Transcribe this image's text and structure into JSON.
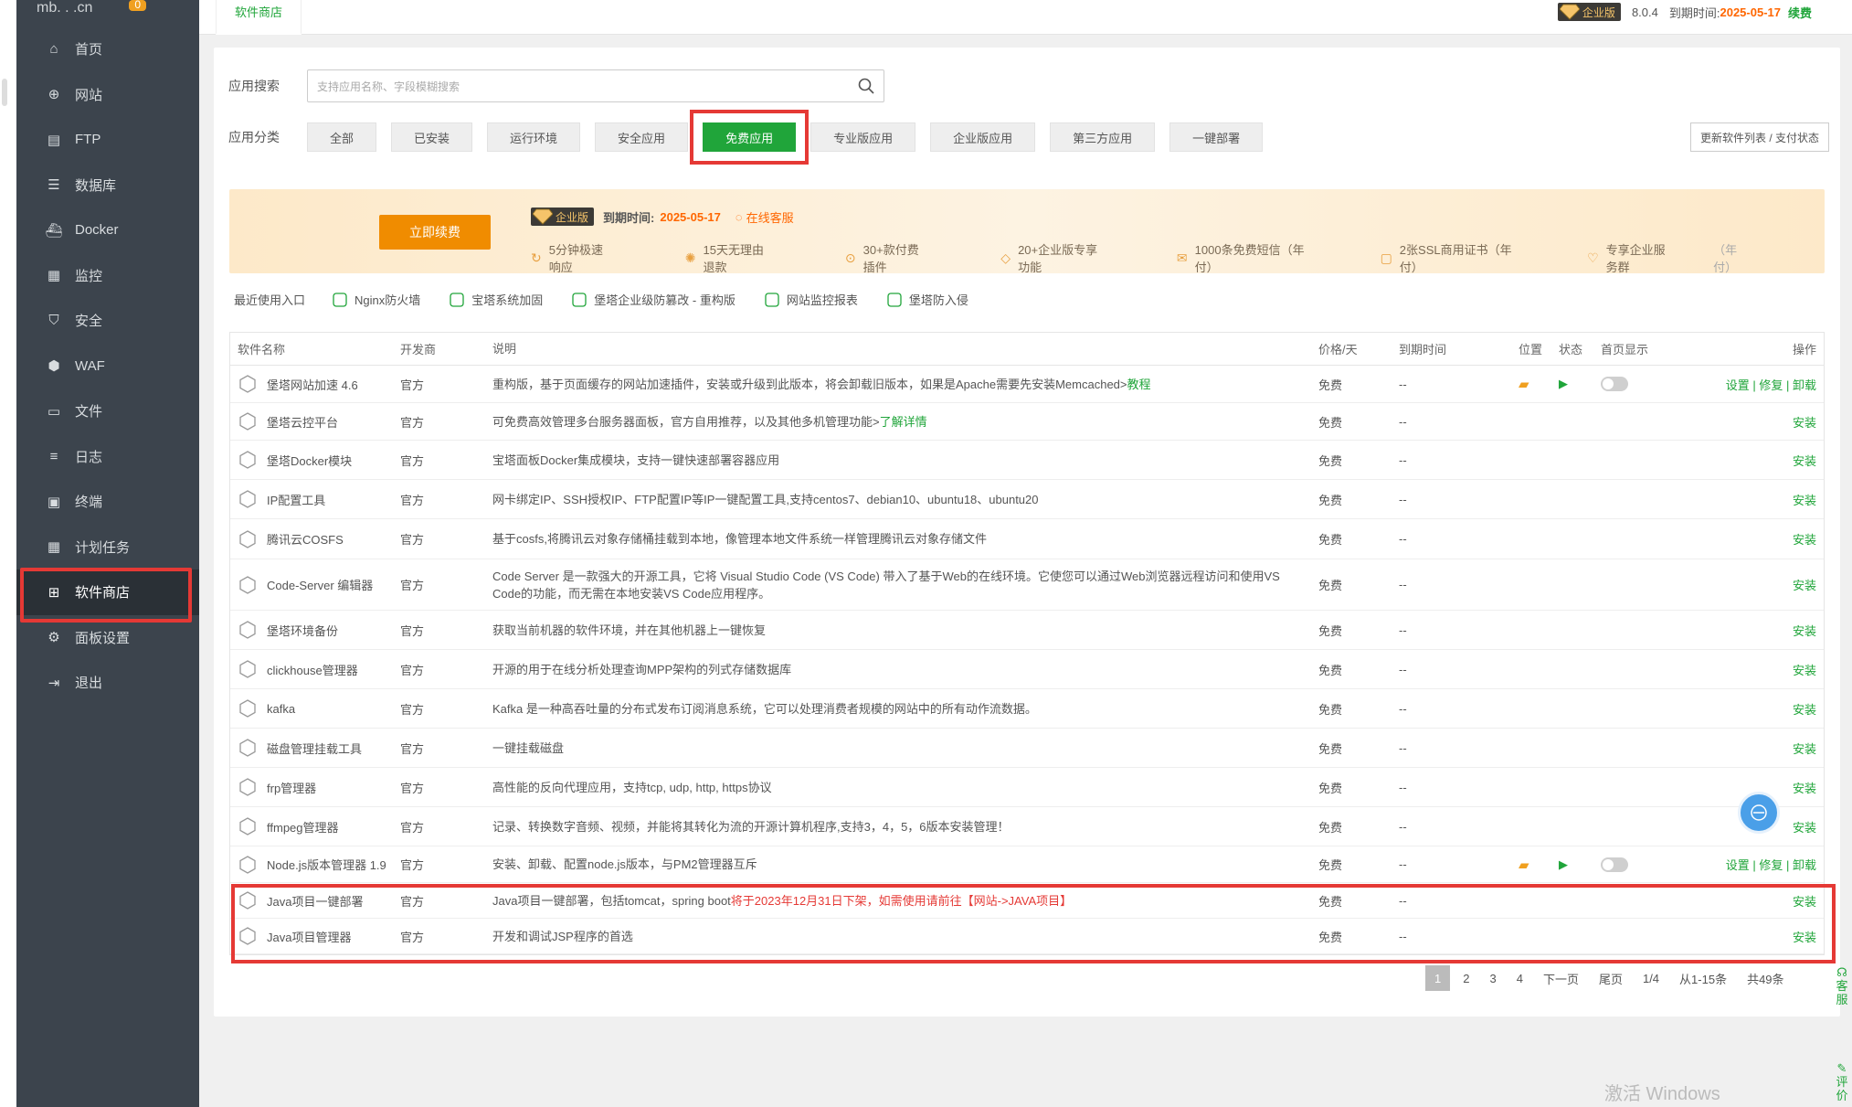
{
  "logo": {
    "text": "mb.   .   .cn",
    "badge": "0"
  },
  "sidebar": {
    "items": [
      {
        "label": "首页",
        "icon": "home-icon"
      },
      {
        "label": "网站",
        "icon": "globe-icon"
      },
      {
        "label": "FTP",
        "icon": "ftp-icon"
      },
      {
        "label": "数据库",
        "icon": "database-icon"
      },
      {
        "label": "Docker",
        "icon": "docker-icon"
      },
      {
        "label": "监控",
        "icon": "monitor-icon"
      },
      {
        "label": "安全",
        "icon": "shield-icon"
      },
      {
        "label": "WAF",
        "icon": "waf-icon"
      },
      {
        "label": "文件",
        "icon": "folder-icon"
      },
      {
        "label": "日志",
        "icon": "log-icon"
      },
      {
        "label": "终端",
        "icon": "terminal-icon"
      },
      {
        "label": "计划任务",
        "icon": "calendar-icon"
      },
      {
        "label": "软件商店",
        "icon": "grid-icon"
      },
      {
        "label": "面板设置",
        "icon": "gear-icon"
      },
      {
        "label": "退出",
        "icon": "logout-icon"
      }
    ]
  },
  "topbar": {
    "crumb": "软件商店",
    "edition": "企业版",
    "version": "8.0.4",
    "expire_label": "到期时间:",
    "expire_date": "2025-05-17",
    "renew": "续费"
  },
  "search": {
    "label": "应用搜索",
    "placeholder": "支持应用名称、字段模糊搜索"
  },
  "categories": {
    "label": "应用分类",
    "items": [
      "全部",
      "已安装",
      "运行环境",
      "安全应用",
      "免费应用",
      "专业版应用",
      "企业版应用",
      "第三方应用",
      "一键部署"
    ],
    "active": "免费应用",
    "update_btn": "更新软件列表 / 支付状态"
  },
  "promo": {
    "renew_btn": "立即续费",
    "edition": "企业版",
    "expire_label": "到期时间:",
    "expire_date": "2025-05-17",
    "service": "在线客服",
    "features": [
      "5分钟极速响应",
      "15天无理由退款",
      "30+款付费插件",
      "20+企业版专享功能",
      "1000条免费短信（年付）",
      "2张SSL商用证书（年付）",
      "专享企业服务群"
    ],
    "last_suffix": "（年付）"
  },
  "recent": {
    "title": "最近使用入口",
    "items": [
      "Nginx防火墙",
      "宝塔系统加固",
      "堡塔企业级防篡改 - 重构版",
      "网站监控报表",
      "堡塔防入侵"
    ]
  },
  "table": {
    "headers": {
      "name": "软件名称",
      "dev": "开发商",
      "desc": "说明",
      "price": "价格/天",
      "expire": "到期时间",
      "pos": "位置",
      "status": "状态",
      "home": "首页显示",
      "op": "操作"
    },
    "rows": [
      {
        "name": "堡塔网站加速 4.6",
        "dev": "官方",
        "desc": "重构版，基于页面缓存的网站加速插件，安装或升级到此版本，将会卸载旧版本，如果是Apache需要先安装Memcached>",
        "link": "教程",
        "price": "免费",
        "expire": "--",
        "op": "设置 | 修复 | 卸载",
        "installed": true
      },
      {
        "name": "堡塔云控平台",
        "dev": "官方",
        "desc": "可免费高效管理多台服务器面板，官方自用推荐，以及其他多机管理功能>",
        "link": "了解详情",
        "price": "免费",
        "expire": "--",
        "op": "安装"
      },
      {
        "name": "堡塔Docker模块",
        "dev": "官方",
        "desc": "宝塔面板Docker集成模块，支持一键快速部署容器应用",
        "price": "免费",
        "expire": "--",
        "op": "安装"
      },
      {
        "name": "IP配置工具",
        "dev": "官方",
        "desc": "网卡绑定IP、SSH授权IP、FTP配置IP等IP一键配置工具,支持centos7、debian10、ubuntu18、ubuntu20",
        "price": "免费",
        "expire": "--",
        "op": "安装"
      },
      {
        "name": "腾讯云COSFS",
        "dev": "官方",
        "desc": "基于cosfs,将腾讯云对象存储桶挂载到本地，像管理本地文件系统一样管理腾讯云对象存储文件",
        "price": "免费",
        "expire": "--",
        "op": "安装"
      },
      {
        "name": "Code-Server 编辑器",
        "dev": "官方",
        "desc": "Code Server 是一款强大的开源工具，它将 Visual Studio Code (VS Code) 带入了基于Web的在线环境。它使您可以通过Web浏览器远程访问和使用VS Code的功能，而无需在本地安装VS Code应用程序。",
        "price": "免费",
        "expire": "--",
        "op": "安装",
        "tall": true
      },
      {
        "name": "堡塔环境备份",
        "dev": "官方",
        "desc": "获取当前机器的软件环境，并在其他机器上一键恢复",
        "price": "免费",
        "expire": "--",
        "op": "安装"
      },
      {
        "name": "clickhouse管理器",
        "dev": "官方",
        "desc": "开源的用于在线分析处理查询MPP架构的列式存储数据库",
        "price": "免费",
        "expire": "--",
        "op": "安装"
      },
      {
        "name": "kafka",
        "dev": "官方",
        "desc": "Kafka 是一种高吞吐量的分布式发布订阅消息系统，它可以处理消费者规模的网站中的所有动作流数据。",
        "price": "免费",
        "expire": "--",
        "op": "安装"
      },
      {
        "name": "磁盘管理挂载工具",
        "dev": "官方",
        "desc": "一键挂载磁盘",
        "price": "免费",
        "expire": "--",
        "op": "安装"
      },
      {
        "name": "frp管理器",
        "dev": "官方",
        "desc": "高性能的反向代理应用，支持tcp, udp, http, https协议",
        "price": "免费",
        "expire": "--",
        "op": "安装"
      },
      {
        "name": "ffmpeg管理器",
        "dev": "官方",
        "desc": "记录、转换数字音频、视频，并能将其转化为流的开源计算机程序,支持3，4，5，6版本安装管理！",
        "price": "免费",
        "expire": "--",
        "op": "安装"
      },
      {
        "name": "Node.js版本管理器 1.9",
        "dev": "官方",
        "desc": "安装、卸载、配置node.js版本，与PM2管理器互斥",
        "price": "免费",
        "expire": "--",
        "op": "设置 | 修复 | 卸载",
        "installed": true
      },
      {
        "name": "Java项目一键部署",
        "dev": "官方",
        "desc": "Java项目一键部署，包括tomcat，spring boot",
        "warn": "将于2023年12月31日下架，如需使用请前往【网站->JAVA项目】",
        "price": "免费",
        "expire": "--",
        "op": "安装"
      },
      {
        "name": "Java项目管理器",
        "dev": "官方",
        "desc": "开发和调试JSP程序的首选",
        "price": "免费",
        "expire": "--",
        "op": "安装"
      }
    ]
  },
  "pager": {
    "pages": [
      "1",
      "2",
      "3",
      "4"
    ],
    "next": "下一页",
    "last": "尾页",
    "ratio": "1/4",
    "range": "从1-15条",
    "total": "共49条"
  },
  "side_float": {
    "service": "客服",
    "review": "评价"
  },
  "watermark": "激活 Windows"
}
